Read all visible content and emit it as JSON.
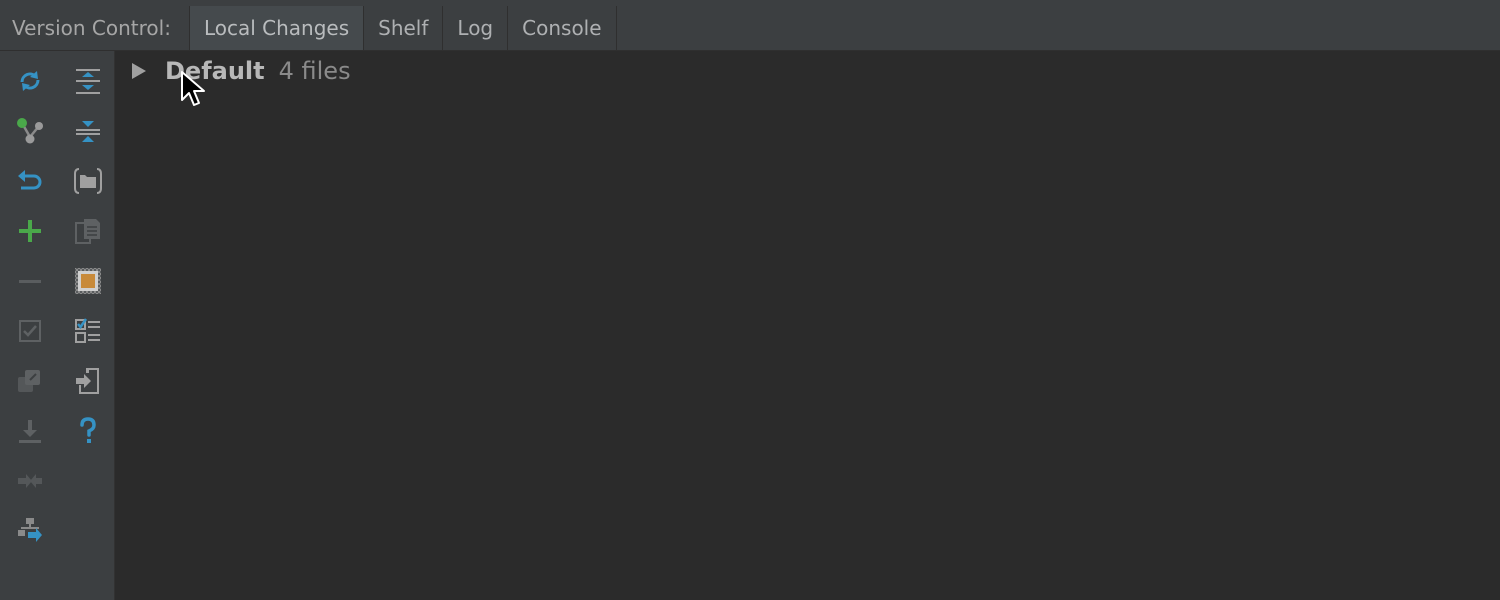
{
  "tabbar": {
    "prefix": "Version Control:",
    "tabs": [
      {
        "label": "Local Changes",
        "active": true
      },
      {
        "label": "Shelf",
        "active": false
      },
      {
        "label": "Log",
        "active": false
      },
      {
        "label": "Console",
        "active": false
      }
    ]
  },
  "toolbar": {
    "left_column": [
      {
        "icon": "refresh-icon"
      },
      {
        "icon": "branch-icon"
      },
      {
        "icon": "undo-icon"
      },
      {
        "icon": "add-icon"
      },
      {
        "icon": "remove-icon"
      },
      {
        "icon": "checkbox-icon"
      },
      {
        "icon": "copy-changelist-icon"
      },
      {
        "icon": "download-icon"
      },
      {
        "icon": "merge-icon"
      },
      {
        "icon": "structure-icon"
      }
    ],
    "right_column": [
      {
        "icon": "expand-all-icon"
      },
      {
        "icon": "collapse-all-icon"
      },
      {
        "icon": "group-by-folder-icon"
      },
      {
        "icon": "show-diff-icon"
      },
      {
        "icon": "preview-icon"
      },
      {
        "icon": "checklist-icon"
      },
      {
        "icon": "import-icon"
      },
      {
        "icon": "help-icon"
      }
    ]
  },
  "changelist": {
    "name": "Default",
    "count": "4 files"
  },
  "colors": {
    "accent_blue": "#3592c4",
    "accent_green": "#499c54",
    "bright_green": "#4aa84a",
    "background": "#2b2b2b",
    "panel": "#3c3f41"
  }
}
